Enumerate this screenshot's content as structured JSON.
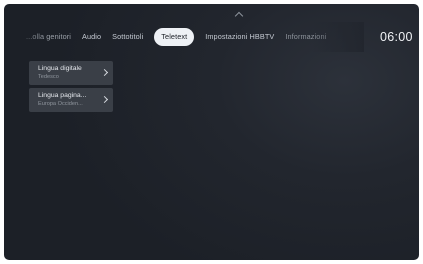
{
  "tabs": [
    {
      "label": "...olla genitori"
    },
    {
      "label": "Audio"
    },
    {
      "label": "Sottotitoli"
    },
    {
      "label": "Teletext",
      "active": true
    },
    {
      "label": "Impostazioni HBBTV"
    },
    {
      "label": "Informazioni"
    }
  ],
  "clock": "06:00",
  "menu": [
    {
      "title": "Lingua digitale",
      "value": "Tedesco"
    },
    {
      "title": "Lingua pagina...",
      "value": "Europa Occiden..."
    }
  ],
  "colors": {
    "background": "#22262e",
    "active_tab": "#eef1f5",
    "menu_item": "#3a3f47"
  }
}
